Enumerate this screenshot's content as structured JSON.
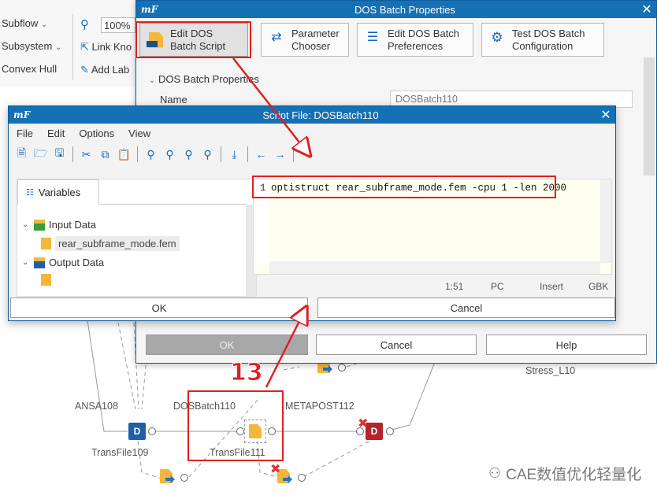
{
  "background": {
    "sidebar": [
      "Subflow",
      "Subsystem",
      "Convex Hull"
    ],
    "tools": [
      "100%",
      "Link Kno",
      "Add Lab"
    ],
    "nodes": {
      "ansa": "ANSA108",
      "dosbatch": "DOSBatch110",
      "metapost": "METAPOST112",
      "transfile": "TransFile109",
      "transfile2": "TransFile111",
      "stress": "Stress_L10"
    }
  },
  "properties_dialog": {
    "title": "DOS Batch Properties",
    "buttons": [
      {
        "label": "Edit DOS Batch Script",
        "icon": "script-file-icon"
      },
      {
        "label": "Parameter Chooser",
        "icon": "parameter-icon"
      },
      {
        "label": "Edit DOS Batch Preferences",
        "icon": "preferences-icon"
      },
      {
        "label": "Test DOS Batch Configuration",
        "icon": "gears-icon"
      }
    ],
    "section": "DOS Batch Properties",
    "name_label": "Name",
    "name_value": "DOSBatch110",
    "ok": "OK",
    "cancel": "Cancel",
    "help": "Help"
  },
  "script_dialog": {
    "title": "Script File: DOSBatch110",
    "menu": [
      "File",
      "Edit",
      "Options",
      "View"
    ],
    "tab": "Variables",
    "tree": {
      "input": "Input Data",
      "input_file": "rear_subframe_mode.fem",
      "output": "Output Data"
    },
    "line_number": "1",
    "code": "optistruct rear_subframe_mode.fem -cpu 1 -len 2000",
    "status": {
      "pos": "1:51",
      "eol": "PC",
      "mode": "Insert",
      "enc": "GBK"
    },
    "ok": "OK",
    "cancel": "Cancel"
  },
  "annotation": {
    "step": "13"
  },
  "watermark": "CAE数值优化轻量化",
  "colors": {
    "titlebar": "#1570b4",
    "annotation": "#e02020"
  }
}
